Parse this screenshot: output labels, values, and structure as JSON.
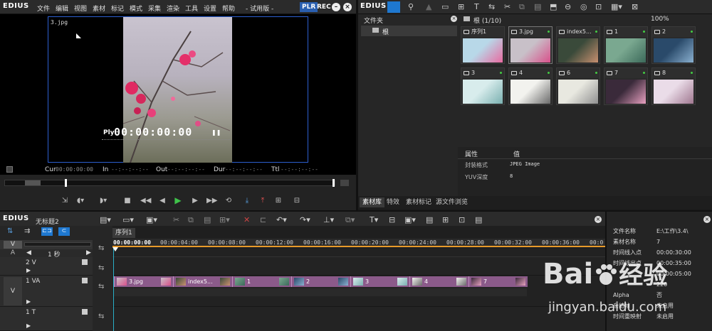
{
  "player": {
    "app_name": "EDIUS",
    "menu": [
      "文件",
      "编辑",
      "视图",
      "素材",
      "标记",
      "模式",
      "采集",
      "渲染",
      "工具",
      "设置",
      "帮助"
    ],
    "edition": "- 试用版 -",
    "plr_label": "PLR",
    "rec_label": "REC",
    "clip_name": "3.jpg",
    "overlay_mode": "Ply",
    "overlay_timecode": "00:00:00:00",
    "cur_label": "Cur",
    "cur_value": "00:00:00:00",
    "in_label": "In",
    "in_value": "--:--:--:--",
    "out_label": "Out",
    "out_value": "--:--:--:--",
    "dur_label": "Dur",
    "dur_value": "--:--:--:--",
    "ttl_label": "Ttl",
    "ttl_value": "--:--:--:--"
  },
  "bin": {
    "app_name": "EDIUS",
    "folder_header": "文件夹",
    "folder_root": "根",
    "path_label": "根 (1/10)",
    "zoom": "100%",
    "clips": [
      {
        "name": "序列1",
        "kind": "seq",
        "c1": "#b8d8e8",
        "c2": "#e86aa0"
      },
      {
        "name": "3.jpg",
        "kind": "img",
        "c1": "#c8c0c8",
        "c2": "#d8508a"
      },
      {
        "name": "index5...",
        "kind": "img",
        "c1": "#3a4a3a",
        "c2": "#c89070"
      },
      {
        "name": "1",
        "kind": "img",
        "c1": "#7aa890",
        "c2": "#3c6a5a"
      },
      {
        "name": "2",
        "kind": "img",
        "c1": "#2a4a6a",
        "c2": "#8ab0d0"
      },
      {
        "name": "3",
        "kind": "img",
        "c1": "#d8ecec",
        "c2": "#7ab0b0"
      },
      {
        "name": "4",
        "kind": "img",
        "c1": "#f2f2ee",
        "c2": "#6a6a6a"
      },
      {
        "name": "6",
        "kind": "img",
        "c1": "#e8e8e0",
        "c2": "#909090"
      },
      {
        "name": "7",
        "kind": "img",
        "c1": "#3a2a3a",
        "c2": "#e8a0c0"
      },
      {
        "name": "8",
        "kind": "img",
        "c1": "#eadce8",
        "c2": "#a07890"
      }
    ],
    "props_header": [
      "属性",
      "值"
    ],
    "props": [
      {
        "k": "封装格式",
        "v": "JPEG Image"
      },
      {
        "k": "YUV深度",
        "v": "8"
      }
    ],
    "tabs": [
      "素材库",
      "特效",
      "素材标记",
      "源文件浏览"
    ]
  },
  "timeline": {
    "app_name": "EDIUS",
    "project_name": "无标题2",
    "sequence_tab": "序列1",
    "timecode": "00:00:00:00",
    "scale": "1 秒",
    "ruler": [
      "00:00:04:00",
      "00:00:08:00",
      "00:00:12:00",
      "00:00:16:00",
      "00:00:20:00",
      "00:00:24:00",
      "00:00:28:00",
      "00:00:32:00",
      "00:00:36:00",
      "00:0"
    ],
    "tracks": [
      {
        "name": "2 V",
        "sel": ""
      },
      {
        "name": "1 VA",
        "sel": "V"
      },
      {
        "name": "1 T",
        "sel": ""
      }
    ],
    "v_label": "V",
    "a_label": "A",
    "clips": [
      {
        "name": "3.jpg",
        "c1": "#c8c0c8",
        "c2": "#d8508a"
      },
      {
        "name": "index5...",
        "c1": "#3a4a3a",
        "c2": "#c89070"
      },
      {
        "name": "1",
        "c1": "#7aa890",
        "c2": "#3c6a5a"
      },
      {
        "name": "2",
        "c1": "#2a4a6a",
        "c2": "#8ab0d0"
      },
      {
        "name": "3",
        "c1": "#d8ecec",
        "c2": "#7ab0b0"
      },
      {
        "name": "4",
        "c1": "#f2f2ee",
        "c2": "#6a6a6a"
      },
      {
        "name": "7",
        "c1": "#3a2a3a",
        "c2": "#e8a0c0"
      }
    ]
  },
  "info_panel": {
    "rows": [
      {
        "k": "文件名称",
        "v": "E:\\工作\\3.4\\"
      },
      {
        "k": "素材名称",
        "v": "7"
      },
      {
        "k": "时间线入点",
        "v": "00:00:30:00"
      },
      {
        "k": "时间线出点",
        "v": "00:00:35:00"
      },
      {
        "k": "",
        "v": "00:00:05:00"
      },
      {
        "k": "",
        "v": "220"
      },
      {
        "k": "Alpha",
        "v": "否"
      },
      {
        "k": "亲结帧",
        "v": "未启用"
      },
      {
        "k": "时间重映射",
        "v": "未启用"
      }
    ]
  },
  "watermark": {
    "brand": "Bai",
    "brand2": "经验",
    "url": "jingyan.baidu.com"
  },
  "colors": {
    "accent_blue": "#1e78d0",
    "clip_purple": "#8b5a8a",
    "playhead_orange": "#e89a2a"
  }
}
